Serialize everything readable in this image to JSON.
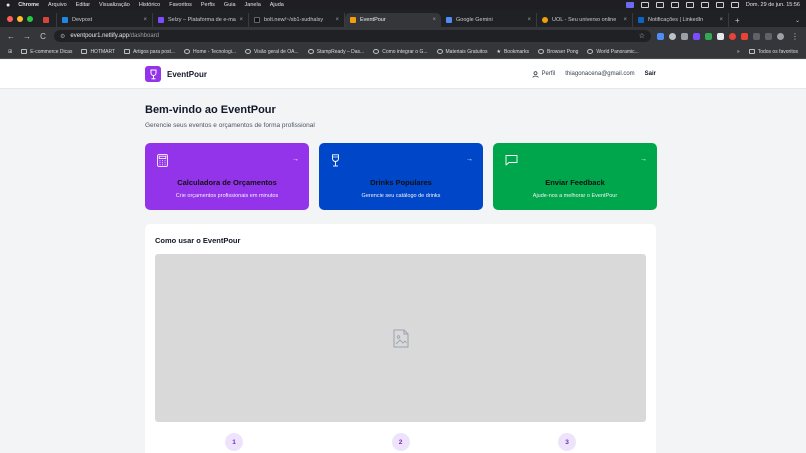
{
  "menubar": {
    "apple": "",
    "items": [
      "Chrome",
      "Arquivo",
      "Editar",
      "Visualização",
      "Histórico",
      "Favoritos",
      "Perfis",
      "Guia",
      "Janela",
      "Ajuda"
    ],
    "clock": "Dom. 29 de jun.  15:56"
  },
  "tabs": [
    {
      "title": "",
      "favicon_color": "#d44638",
      "pinned": true
    },
    {
      "title": "Devpost",
      "favicon_color": "#1e88e5"
    },
    {
      "title": "Selzy – Plataforma de e-mail",
      "favicon_color": "#7c4dff"
    },
    {
      "title": "bolt.new/~/sb1-sudhalsy",
      "favicon_color": "#111111"
    },
    {
      "title": "EventPour",
      "favicon_color": "#f59e0b",
      "active": true
    },
    {
      "title": "Google Gemini",
      "favicon_color": "#4f8df5"
    },
    {
      "title": "UOL - Seu universo online",
      "favicon_color": "#f59e0b"
    },
    {
      "title": "Notificações | LinkedIn",
      "favicon_color": "#0a66c2"
    }
  ],
  "toolbar": {
    "back": "←",
    "forward": "→",
    "reload": "C",
    "url_host": "eventpour1.netlify.app",
    "url_path": "/dashboard",
    "star": "☆",
    "menu": "⋮"
  },
  "bookmarks": {
    "apps_icon": "⊞",
    "items": [
      {
        "label": "E-commerce Dicas",
        "icon": "folder-icon"
      },
      {
        "label": "HOTMART",
        "icon": "folder-icon"
      },
      {
        "label": "Artigos para post...",
        "icon": "folder-icon"
      },
      {
        "label": "Home - Tecnologi...",
        "icon": "site-icon"
      },
      {
        "label": "Visão geral de OA...",
        "icon": "site-icon"
      },
      {
        "label": "StampReady – Das...",
        "icon": "site-icon"
      },
      {
        "label": "Como integrar o G...",
        "icon": "site-icon"
      },
      {
        "label": "Materiais Gratuitos",
        "icon": "site-icon"
      },
      {
        "label": "Bookmarks",
        "icon": "star-icon"
      },
      {
        "label": "Browser Pong",
        "icon": "site-icon"
      },
      {
        "label": "World Panoramic...",
        "icon": "site-icon"
      }
    ],
    "more": "»",
    "others": "Todos os favoritos"
  },
  "header": {
    "brand": "EventPour",
    "profile": "Perfil",
    "email": "thiagonacena@gmail.com",
    "logout": "Sair"
  },
  "main": {
    "welcome": "Bem-vindo ao EventPour",
    "subtitle": "Gerencie seus eventos e orçamentos de forma profissional",
    "cards": [
      {
        "title": "Calculadora de Orçamentos",
        "desc": "Crie orçamentos profissionais em minutos",
        "color": "#9333ea",
        "icon": "calculator-icon"
      },
      {
        "title": "Drinks Populares",
        "desc": "Gerencie seu catálogo de drinks",
        "color": "#0046c8",
        "icon": "wine-glass-icon"
      },
      {
        "title": "Enviar Feedback",
        "desc": "Ajude-nos a melhorar o EventPour",
        "color": "#00a64c",
        "icon": "message-icon"
      }
    ],
    "arrow": "→",
    "howto_title": "Como usar o EventPour",
    "steps": [
      "1",
      "2",
      "3"
    ]
  }
}
